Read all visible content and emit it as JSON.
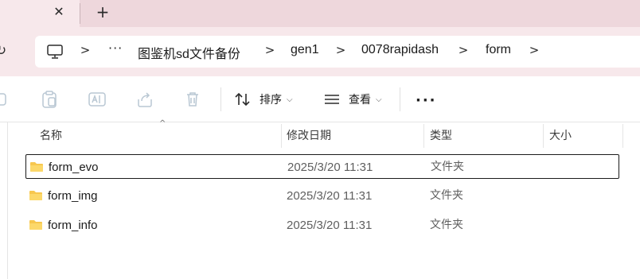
{
  "tabs": {
    "close_glyph": "✕",
    "new_glyph": "+"
  },
  "address": {
    "more_glyph": "···",
    "crumbs": [
      "图鉴机sd文件备份",
      "gen1",
      "0078rapidash",
      "form"
    ]
  },
  "toolbar": {
    "sort_label": "排序",
    "view_label": "查看",
    "more_glyph": "···",
    "icons": [
      "copy-icon",
      "paste-icon",
      "rename-icon",
      "share-icon",
      "delete-icon"
    ]
  },
  "columns": {
    "name": "名称",
    "date": "修改日期",
    "type": "类型",
    "size": "大小"
  },
  "files": [
    {
      "name": "form_evo",
      "date": "2025/3/20 11:31",
      "type": "文件夹",
      "selected": true
    },
    {
      "name": "form_img",
      "date": "2025/3/20 11:31",
      "type": "文件夹",
      "selected": false
    },
    {
      "name": "form_info",
      "date": "2025/3/20 11:31",
      "type": "文件夹",
      "selected": false
    }
  ],
  "colors": {
    "tabstrip": "#eed7dc",
    "active_tab": "#f7e8eb",
    "folder": "#f7c74f"
  }
}
